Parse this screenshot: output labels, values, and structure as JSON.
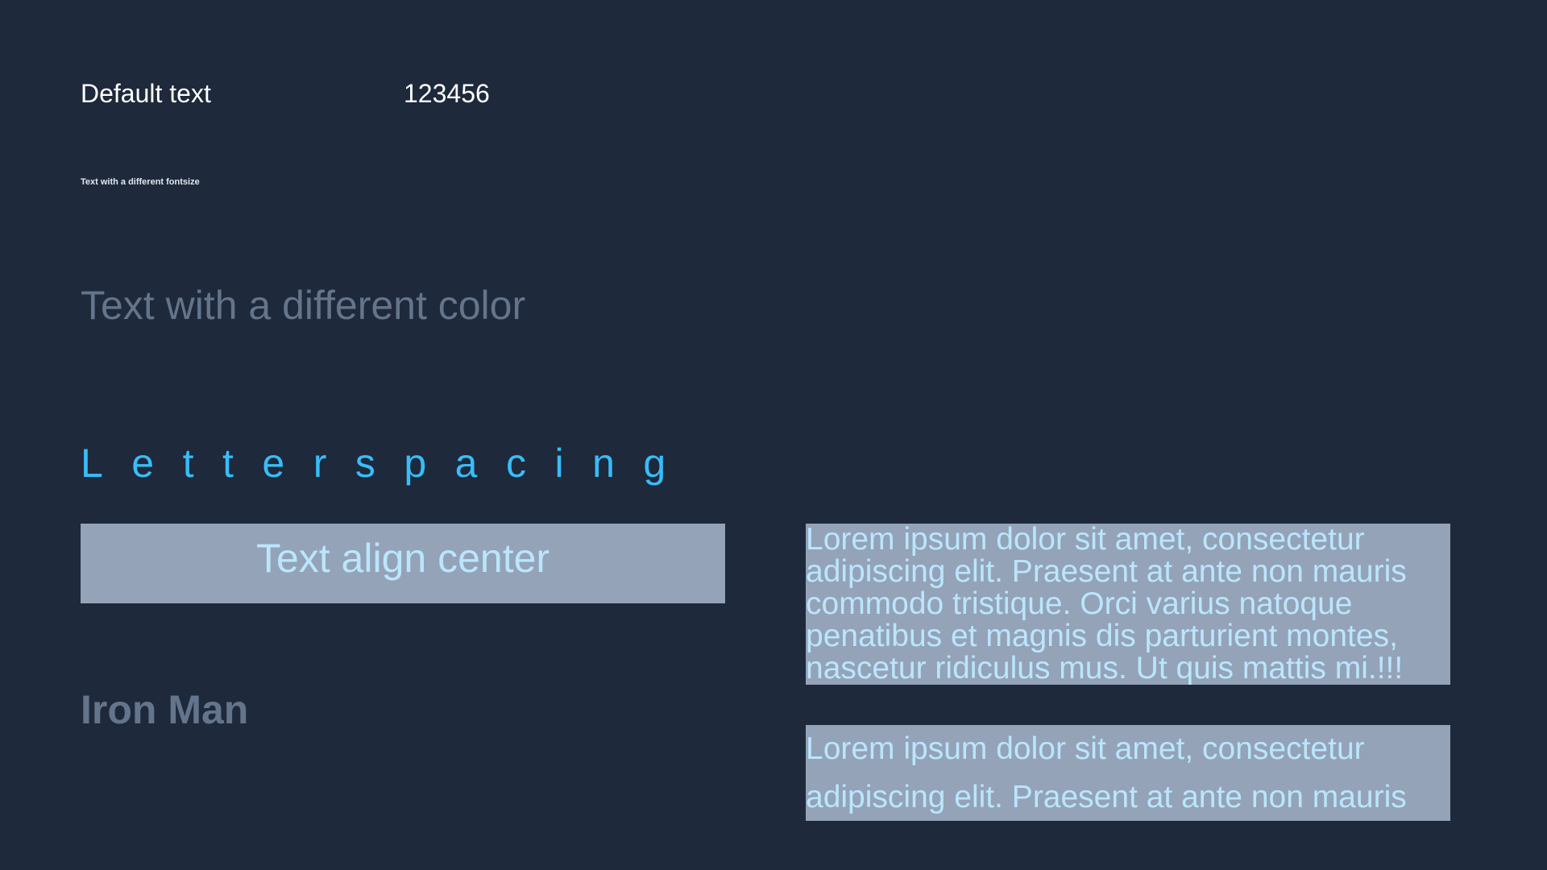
{
  "colors": {
    "background": "#1e293b",
    "box": "#94a3b8",
    "box_text": "#bae6fd",
    "accent": "#38bdf8",
    "muted": "#64748b"
  },
  "texts": {
    "default": "Default text",
    "number": "123456",
    "fontsize": "Text with a different fontsize",
    "color": "Text with a different color",
    "letterspacing": "Letterspacing",
    "align_center": "Text align center",
    "iron_man": "Iron Man",
    "paragraph1": "Lorem ipsum dolor sit amet, consectetur adipiscing elit. Praesent at ante non mauris commodo tristique. Orci varius natoque penatibus et magnis dis parturient montes, nascetur ridiculus mus. Ut quis mattis mi.!!!",
    "paragraph2": "Lorem ipsum dolor sit amet, consectetur adipiscing elit. Praesent at ante non mauris"
  }
}
